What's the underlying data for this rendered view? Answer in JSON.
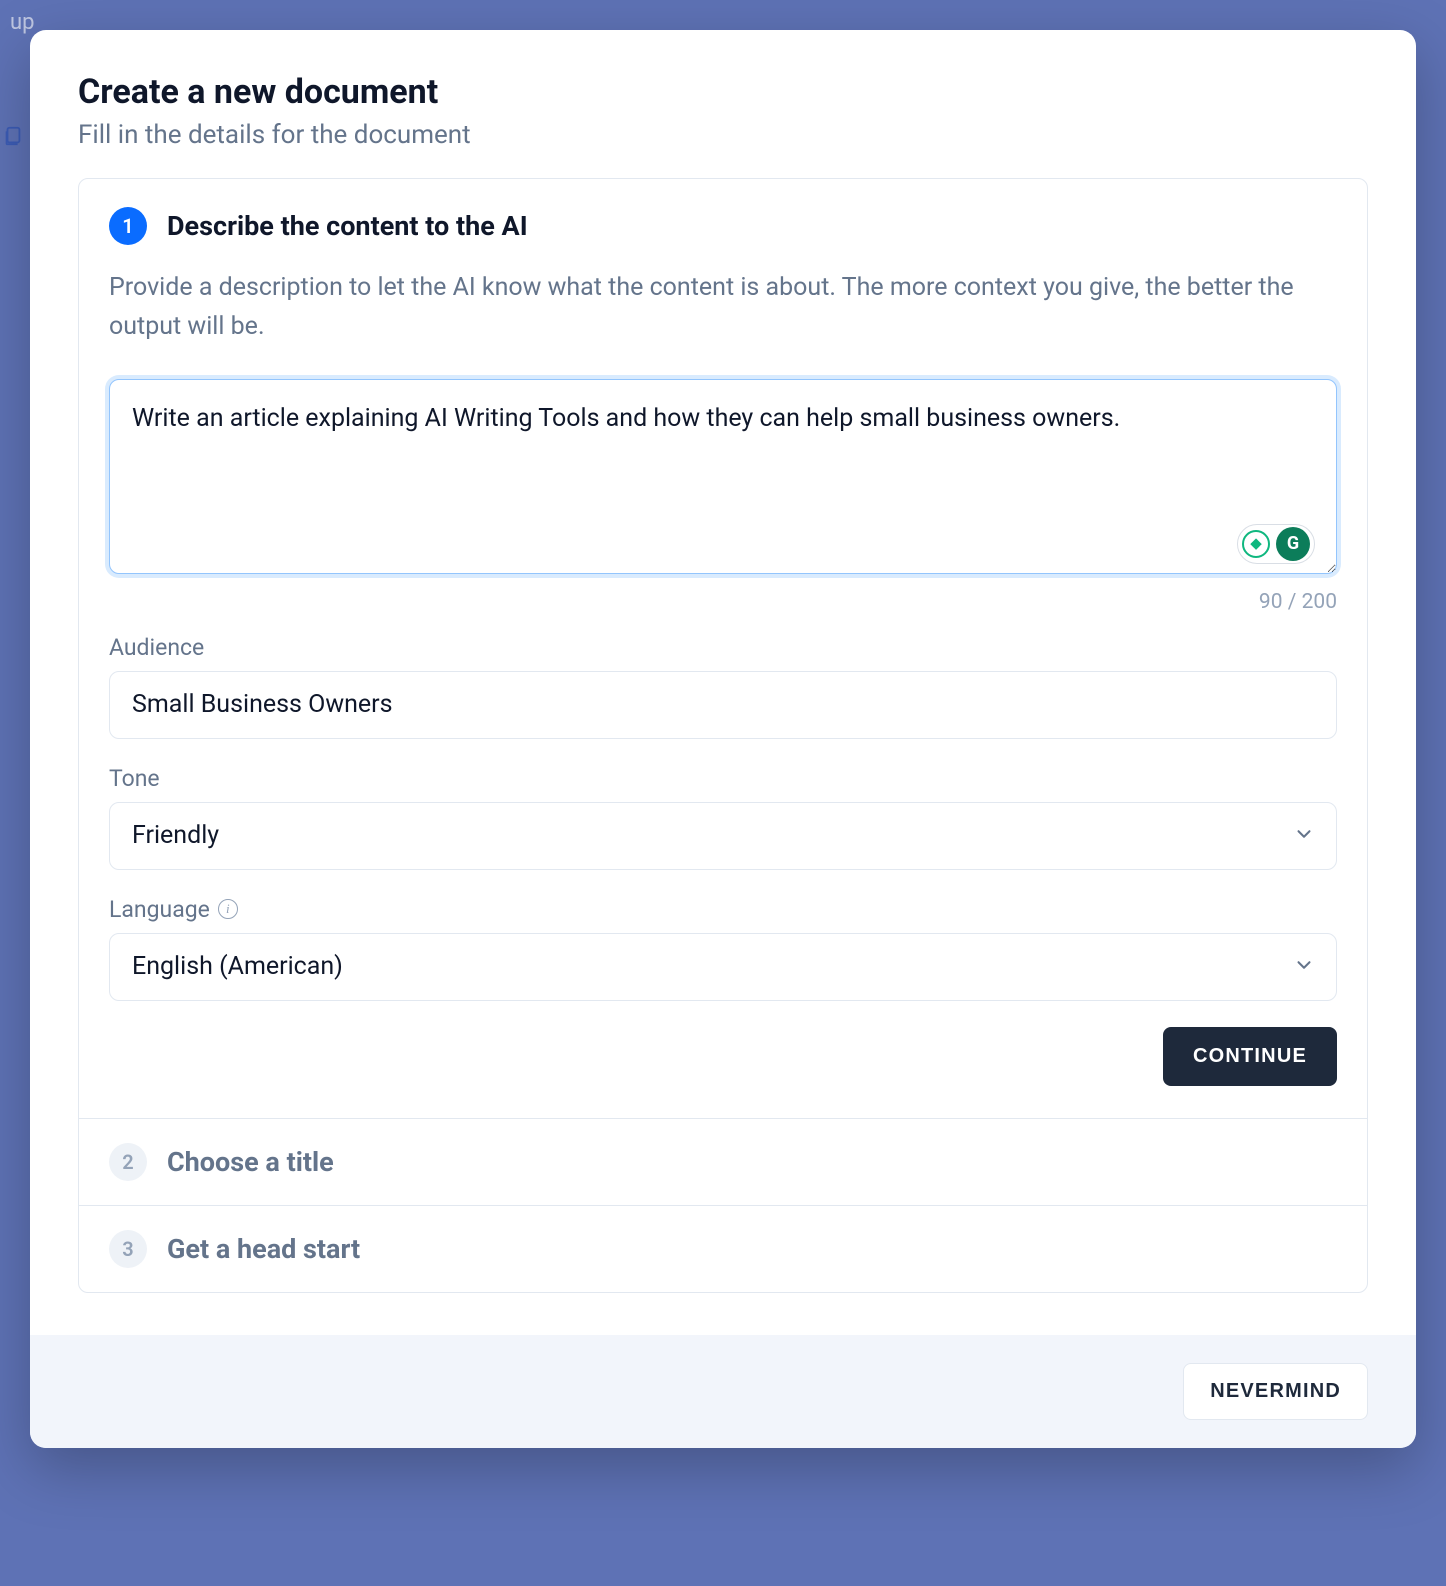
{
  "background": {
    "text": "up"
  },
  "modal": {
    "title": "Create a new document",
    "subtitle": "Fill in the details for the document"
  },
  "step1": {
    "number": "1",
    "title": "Describe the content to the AI",
    "description": "Provide a description to let the AI know what the content is about. The more context you give, the better the output will be.",
    "textarea_value": "Write an article explaining AI Writing Tools and how they can help small business owners.",
    "char_counter": "90 / 200",
    "audience_label": "Audience",
    "audience_value": "Small Business Owners",
    "tone_label": "Tone",
    "tone_value": "Friendly",
    "language_label": "Language",
    "language_value": "English (American)",
    "continue_label": "CONTINUE"
  },
  "step2": {
    "number": "2",
    "title": "Choose a title"
  },
  "step3": {
    "number": "3",
    "title": "Get a head start"
  },
  "footer": {
    "nevermind_label": "NEVERMIND"
  }
}
